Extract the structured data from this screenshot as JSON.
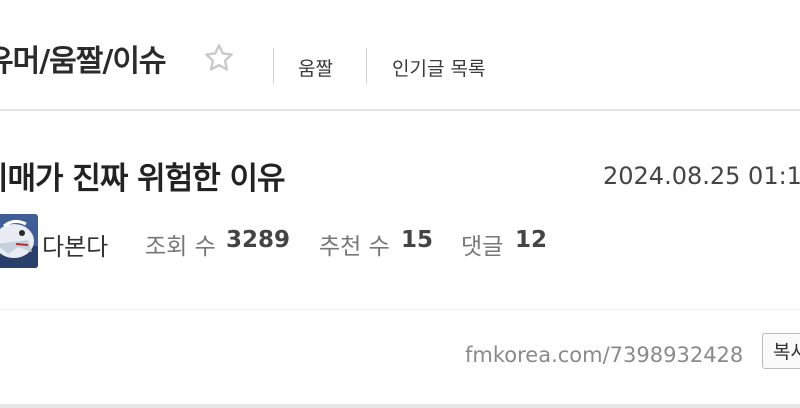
{
  "board": {
    "title": "유머/움짤/이슈",
    "favorite_icon": "star-outline-icon",
    "nav": [
      "움짤",
      "인기글 목록"
    ]
  },
  "post": {
    "title": "이매가 진짜 위험한 이유",
    "date": "2024.08.25 01:1",
    "author": "다본다",
    "avatar_icon": "cartoon-mascot-avatar",
    "stats": [
      {
        "label": "조회 수",
        "value": "3289"
      },
      {
        "label": "추천 수",
        "value": "15"
      },
      {
        "label": "댓글",
        "value": "12"
      }
    ],
    "url": "fmkorea.com/7398932428",
    "copy_label": "복사"
  }
}
